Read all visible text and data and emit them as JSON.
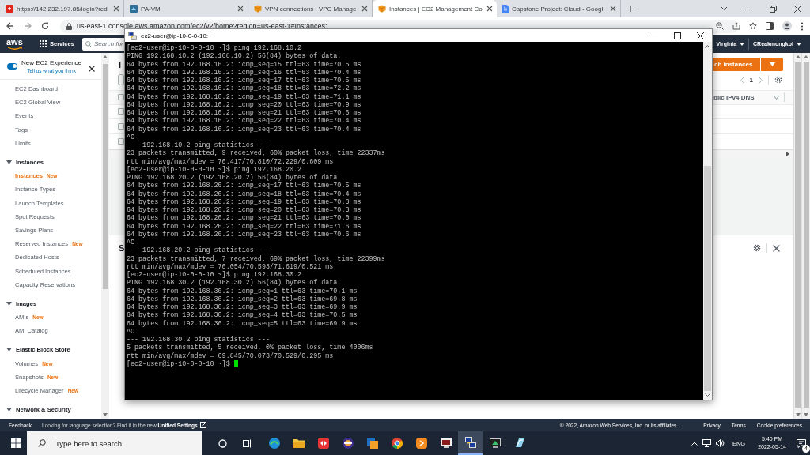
{
  "browser": {
    "tabs": [
      {
        "title": "https://142.232.197.85/login?red",
        "kind": "shield",
        "selected": false
      },
      {
        "title": "PA-VM",
        "kind": "panel",
        "selected": false
      },
      {
        "title": "VPN connections | VPC Manage",
        "kind": "cube",
        "selected": false
      },
      {
        "title": "Instances | EC2 Management Co",
        "kind": "cube",
        "selected": true
      },
      {
        "title": "Capstone Project: Cloud - Googl",
        "kind": "document",
        "selected": false
      }
    ],
    "new_tab": "+",
    "address": "us-east-1.console.aws.amazon.com/ec2/v2/home?region=us-east-1#Instances:"
  },
  "aws_nav": {
    "logo": "aws",
    "services": "Services",
    "search_placeholder": "Search for",
    "region": "Virginia",
    "account": "CReakmongkol"
  },
  "sidebar": {
    "toggle_label": "New EC2 Experience",
    "toggle_on": true,
    "feedback_link": "Tell us what you think",
    "top_items": [
      {
        "label": "EC2 Dashboard",
        "selected": false
      },
      {
        "label": "EC2 Global View",
        "selected": false
      },
      {
        "label": "Events",
        "selected": false
      },
      {
        "label": "Tags",
        "selected": false
      },
      {
        "label": "Limits",
        "selected": false
      }
    ],
    "sections": [
      {
        "title": "Instances",
        "expanded": true,
        "items": [
          {
            "label": "Instances",
            "selected": true,
            "badge": "New"
          },
          {
            "label": "Instance Types",
            "selected": false
          },
          {
            "label": "Launch Templates",
            "selected": false
          },
          {
            "label": "Spot Requests",
            "selected": false
          },
          {
            "label": "Savings Plans",
            "selected": false
          },
          {
            "label": "Reserved Instances",
            "selected": false,
            "badge": "New"
          },
          {
            "label": "Dedicated Hosts",
            "selected": false
          },
          {
            "label": "Scheduled Instances",
            "selected": false
          },
          {
            "label": "Capacity Reservations",
            "selected": false
          }
        ]
      },
      {
        "title": "Images",
        "expanded": true,
        "items": [
          {
            "label": "AMIs",
            "selected": false,
            "badge": "New"
          },
          {
            "label": "AMI Catalog",
            "selected": false
          }
        ]
      },
      {
        "title": "Elastic Block Store",
        "expanded": true,
        "items": [
          {
            "label": "Volumes",
            "selected": false,
            "badge": "New"
          },
          {
            "label": "Snapshots",
            "selected": false,
            "badge": "New"
          },
          {
            "label": "Lifecycle Manager",
            "selected": false,
            "badge": "New"
          }
        ]
      },
      {
        "title": "Network & Security",
        "expanded": true
      }
    ]
  },
  "instances_panel": {
    "heading": "I",
    "launch_button": "ch instances",
    "page": "1",
    "column": "blic IPv4 DNS",
    "header_checked": false,
    "rows": [
      {
        "checked": false
      },
      {
        "checked": false
      },
      {
        "checked": false
      }
    ]
  },
  "details_panel": {
    "heading": "S"
  },
  "terminal": {
    "title": "ec2-user@ip-10-0-0-10:~",
    "lines": [
      "[ec2-user@ip-10-0-0-10 ~]$ ping 192.168.10.2",
      "PING 192.168.10.2 (192.168.10.2) 56(84) bytes of data.",
      "64 bytes from 192.168.10.2: icmp_seq=15 ttl=63 time=70.5 ms",
      "64 bytes from 192.168.10.2: icmp_seq=16 ttl=63 time=70.4 ms",
      "64 bytes from 192.168.10.2: icmp_seq=17 ttl=63 time=70.5 ms",
      "64 bytes from 192.168.10.2: icmp_seq=18 ttl=63 time=72.2 ms",
      "64 bytes from 192.168.10.2: icmp_seq=19 ttl=63 time=71.1 ms",
      "64 bytes from 192.168.10.2: icmp_seq=20 ttl=63 time=70.9 ms",
      "64 bytes from 192.168.10.2: icmp_seq=21 ttl=63 time=70.6 ms",
      "64 bytes from 192.168.10.2: icmp_seq=22 ttl=63 time=70.4 ms",
      "64 bytes from 192.168.10.2: icmp_seq=23 ttl=63 time=70.4 ms",
      "^C",
      "--- 192.168.10.2 ping statistics ---",
      "23 packets transmitted, 9 received, 60% packet loss, time 22337ms",
      "rtt min/avg/max/mdev = 70.417/70.810/72.229/0.609 ms",
      "[ec2-user@ip-10-0-0-10 ~]$ ping 192.168.20.2",
      "PING 192.168.20.2 (192.168.20.2) 56(84) bytes of data.",
      "64 bytes from 192.168.20.2: icmp_seq=17 ttl=63 time=70.5 ms",
      "64 bytes from 192.168.20.2: icmp_seq=18 ttl=63 time=70.4 ms",
      "64 bytes from 192.168.20.2: icmp_seq=19 ttl=63 time=70.3 ms",
      "64 bytes from 192.168.20.2: icmp_seq=20 ttl=63 time=70.3 ms",
      "64 bytes from 192.168.20.2: icmp_seq=21 ttl=63 time=70.0 ms",
      "64 bytes from 192.168.20.2: icmp_seq=22 ttl=63 time=71.6 ms",
      "64 bytes from 192.168.20.2: icmp_seq=23 ttl=63 time=70.6 ms",
      "^C",
      "--- 192.168.20.2 ping statistics ---",
      "23 packets transmitted, 7 received, 69% packet loss, time 22399ms",
      "rtt min/avg/max/mdev = 70.054/70.593/71.619/0.521 ms",
      "[ec2-user@ip-10-0-0-10 ~]$ ping 192.168.30.2",
      "PING 192.168.30.2 (192.168.30.2) 56(84) bytes of data.",
      "64 bytes from 192.168.30.2: icmp_seq=1 ttl=63 time=70.1 ms",
      "64 bytes from 192.168.30.2: icmp_seq=2 ttl=63 time=69.8 ms",
      "64 bytes from 192.168.30.2: icmp_seq=3 ttl=63 time=69.9 ms",
      "64 bytes from 192.168.30.2: icmp_seq=4 ttl=63 time=70.5 ms",
      "64 bytes from 192.168.30.2: icmp_seq=5 ttl=63 time=69.9 ms",
      "^C",
      "--- 192.168.30.2 ping statistics ---",
      "5 packets transmitted, 5 received, 0% packet loss, time 4006ms",
      "rtt min/avg/max/mdev = 69.845/70.073/70.529/0.295 ms",
      "[ec2-user@ip-10-0-0-10 ~]$"
    ]
  },
  "footer": {
    "feedback": "Feedback",
    "language_note": "Looking for language selection? Find it in the new **Unified Settings**",
    "copyright": "© 2022, Amazon Web Services, Inc. or its affiliates.",
    "links": [
      "Privacy",
      "Terms",
      "Cookie preferences"
    ]
  },
  "taskbar": {
    "search_placeholder": "Type here to search",
    "apps": [
      {
        "kind": "wave",
        "active": false
      },
      {
        "kind": "folder",
        "active": false
      },
      {
        "kind": "arrows",
        "active": false
      },
      {
        "kind": "ring",
        "active": false
      },
      {
        "kind": "boxes",
        "active": false
      },
      {
        "kind": "round",
        "active": false
      },
      {
        "kind": "badge",
        "active": false
      },
      {
        "kind": "monitor",
        "active": false
      },
      {
        "kind": "terminal",
        "active": true
      },
      {
        "kind": "screen",
        "active": false
      },
      {
        "kind": "glass",
        "active": false
      }
    ],
    "language": "ENG",
    "time": "5:40 PM",
    "date": "2022-05-14",
    "notifications": "4"
  }
}
